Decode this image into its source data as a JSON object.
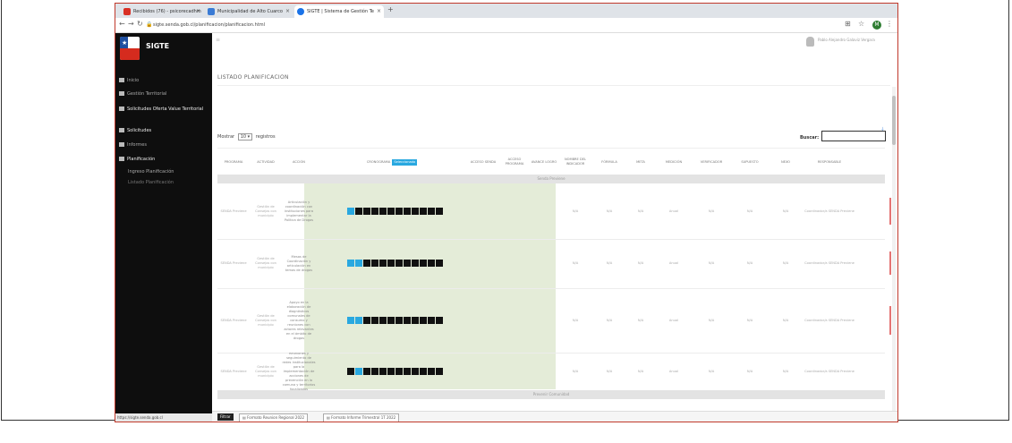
{
  "browser": {
    "tabs": [
      {
        "label": "Recibidos (76) - psicorecadhm",
        "favicon_color": "#d93025"
      },
      {
        "label": "Municipalidad de Alto Cuarco",
        "favicon_color": "#3a7bd5"
      },
      {
        "label": "SIGTE | Sistema de Gestión Te",
        "favicon_color": "#1a73e8"
      }
    ],
    "url": "sigte.senda.gob.cl/planificacion/planificacion.html",
    "profile_initial": "M"
  },
  "sidebar": {
    "app_name": "SIGTE",
    "items": [
      {
        "label": "Inicio"
      },
      {
        "label": "Gestión Territorial"
      },
      {
        "label": "Solicitudes Oferta Value Territorial"
      },
      {
        "label": "Solicitudes"
      },
      {
        "label": "Informes"
      },
      {
        "label": "Planificación"
      },
      {
        "label": "Ingreso Planificación"
      },
      {
        "label": "Listado Planificación"
      }
    ],
    "status_url": "https://sigte.senda.gob.cl"
  },
  "header": {
    "user_name": "Pablo Alejandro Galaviz Vergara"
  },
  "page": {
    "title": "LISTADO PLANIFICACION",
    "show_label": "Mostrar",
    "show_value": "10",
    "records_label": "registros",
    "search_label": "Buscar:",
    "search_value": ""
  },
  "table": {
    "columns": [
      "PROGRAMA",
      "ACTIVIDAD",
      "ACCIÓN",
      "CRONOGRAMA",
      "ACCESO SENDA",
      "ACCESO PROGRAMA",
      "AVANCE LOGRO",
      "NOMBRE DEL INDICADOR",
      "FÓRMULA",
      "META",
      "MEDICIÓN",
      "VERIFICADOR",
      "SUPUESTO",
      "NEXO",
      "RESPONSABLE"
    ],
    "cronograma_badge": "Seleccionado",
    "groups": [
      "Senda Previene",
      "Prevenir Comunidad"
    ],
    "rows": [
      {
        "programa": "SENDA Previene",
        "actividad": "Gestión de Consejos con municipio",
        "accion": "Articulación y coordinación con instituciones para implementar la Política de Drogas",
        "buttons": "BBBBBBBBBBBB",
        "blue": [
          0
        ],
        "values": [
          "N/A",
          "N/A",
          "N/A",
          "Anual",
          "N/A",
          "N/A",
          "N/A",
          "Coordinador/a SENDA Previene"
        ]
      },
      {
        "programa": "SENDA Previene",
        "actividad": "Gestión de Consejos con municipio",
        "accion": "Mesas de Coordinación y articulación en temas de drogas",
        "buttons": "BBBBBBBBBBBB",
        "blue": [
          0,
          1
        ],
        "values": [
          "N/A",
          "N/A",
          "N/A",
          "Anual",
          "N/A",
          "N/A",
          "N/A",
          "Coordinador/a SENDA Previene"
        ]
      },
      {
        "programa": "SENDA Previene",
        "actividad": "Gestión de Consejos con municipio",
        "accion": "Apoyo en la elaboración de diagnósticos comunales de consumo y reuniones con actores relevantes en el ámbito de drogas",
        "buttons": "BBBBBBBBBBBB",
        "blue": [
          0,
          1
        ],
        "values": [
          "N/A",
          "N/A",
          "N/A",
          "Anual",
          "N/A",
          "N/A",
          "N/A",
          "Coordinador/a SENDA Previene"
        ]
      },
      {
        "programa": "SENDA Previene",
        "actividad": "Gestión de Consejos con municipio",
        "accion": "Reuniones y seguimiento de redes institucionales para la implementación de acciones de prevención en la comuna y territorios focalizados",
        "buttons": "BBBBBBBBBBBB",
        "blue": [
          1
        ],
        "values": [
          "N/A",
          "N/A",
          "N/A",
          "Anual",
          "N/A",
          "N/A",
          "N/A",
          "Coordinador/a SENDA Previene"
        ]
      }
    ]
  },
  "bottom": {
    "button_label": "Filtrar",
    "downloads": [
      "Formato Reunion Regional 2022",
      "Formato Informe Trimestral 1T 2022"
    ]
  },
  "colors": {
    "accent_blue": "#29a8e0",
    "green_highlight": "#e4ecd8",
    "sidebar_bg": "#0e0e0e",
    "window_border": "#c0392b"
  }
}
